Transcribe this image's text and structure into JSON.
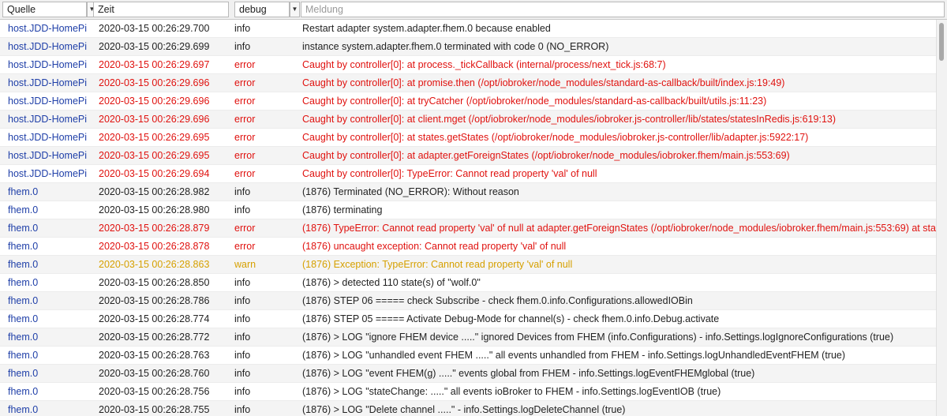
{
  "header": {
    "source_label": "Quelle",
    "time_label": "Zeit",
    "severity_value": "debug",
    "message_placeholder": "Meldung",
    "dropdown_glyph": "▼"
  },
  "colors": {
    "error": "#e0120f",
    "warn": "#d6a000",
    "source": "#1f3fa8"
  },
  "rows": [
    {
      "src": "host.JDD-HomePi",
      "time": "2020-03-15 00:26:29.700",
      "sev": "info",
      "msg": "Restart adapter system.adapter.fhem.0 because enabled"
    },
    {
      "src": "host.JDD-HomePi",
      "time": "2020-03-15 00:26:29.699",
      "sev": "info",
      "msg": "instance system.adapter.fhem.0 terminated with code 0 (NO_ERROR)"
    },
    {
      "src": "host.JDD-HomePi",
      "time": "2020-03-15 00:26:29.697",
      "sev": "error",
      "msg": "Caught by controller[0]: at process._tickCallback (internal/process/next_tick.js:68:7)"
    },
    {
      "src": "host.JDD-HomePi",
      "time": "2020-03-15 00:26:29.696",
      "sev": "error",
      "msg": "Caught by controller[0]: at promise.then (/opt/iobroker/node_modules/standard-as-callback/built/index.js:19:49)"
    },
    {
      "src": "host.JDD-HomePi",
      "time": "2020-03-15 00:26:29.696",
      "sev": "error",
      "msg": "Caught by controller[0]: at tryCatcher (/opt/iobroker/node_modules/standard-as-callback/built/utils.js:11:23)"
    },
    {
      "src": "host.JDD-HomePi",
      "time": "2020-03-15 00:26:29.696",
      "sev": "error",
      "msg": "Caught by controller[0]: at client.mget (/opt/iobroker/node_modules/iobroker.js-controller/lib/states/statesInRedis.js:619:13)"
    },
    {
      "src": "host.JDD-HomePi",
      "time": "2020-03-15 00:26:29.695",
      "sev": "error",
      "msg": "Caught by controller[0]: at states.getStates (/opt/iobroker/node_modules/iobroker.js-controller/lib/adapter.js:5922:17)"
    },
    {
      "src": "host.JDD-HomePi",
      "time": "2020-03-15 00:26:29.695",
      "sev": "error",
      "msg": "Caught by controller[0]: at adapter.getForeignStates (/opt/iobroker/node_modules/iobroker.fhem/main.js:553:69)"
    },
    {
      "src": "host.JDD-HomePi",
      "time": "2020-03-15 00:26:29.694",
      "sev": "error",
      "msg": "Caught by controller[0]: TypeError: Cannot read property 'val' of null"
    },
    {
      "src": "fhem.0",
      "time": "2020-03-15 00:26:28.982",
      "sev": "info",
      "msg": "(1876) Terminated (NO_ERROR): Without reason"
    },
    {
      "src": "fhem.0",
      "time": "2020-03-15 00:26:28.980",
      "sev": "info",
      "msg": "(1876) terminating"
    },
    {
      "src": "fhem.0",
      "time": "2020-03-15 00:26:28.879",
      "sev": "error",
      "msg": "(1876) TypeError: Cannot read property 'val' of null at adapter.getForeignStates (/opt/iobroker/node_modules/iobroker.fhem/main.js:553:69) at sta"
    },
    {
      "src": "fhem.0",
      "time": "2020-03-15 00:26:28.878",
      "sev": "error",
      "msg": "(1876) uncaught exception: Cannot read property 'val' of null"
    },
    {
      "src": "fhem.0",
      "time": "2020-03-15 00:26:28.863",
      "sev": "warn",
      "msg": "(1876) Exception: TypeError: Cannot read property 'val' of null"
    },
    {
      "src": "fhem.0",
      "time": "2020-03-15 00:26:28.850",
      "sev": "info",
      "msg": "(1876) > detected 110 state(s) of \"wolf.0\""
    },
    {
      "src": "fhem.0",
      "time": "2020-03-15 00:26:28.786",
      "sev": "info",
      "msg": "(1876) STEP 06 ===== check Subscribe - check fhem.0.info.Configurations.allowedIOBin"
    },
    {
      "src": "fhem.0",
      "time": "2020-03-15 00:26:28.774",
      "sev": "info",
      "msg": "(1876) STEP 05 ===== Activate Debug-Mode for channel(s) - check fhem.0.info.Debug.activate"
    },
    {
      "src": "fhem.0",
      "time": "2020-03-15 00:26:28.772",
      "sev": "info",
      "msg": "(1876) > LOG \"ignore FHEM device .....\" ignored Devices from FHEM (info.Configurations) - info.Settings.logIgnoreConfigurations (true)"
    },
    {
      "src": "fhem.0",
      "time": "2020-03-15 00:26:28.763",
      "sev": "info",
      "msg": "(1876) > LOG \"unhandled event FHEM .....\" all events unhandled from FHEM - info.Settings.logUnhandledEventFHEM (true)"
    },
    {
      "src": "fhem.0",
      "time": "2020-03-15 00:26:28.760",
      "sev": "info",
      "msg": "(1876) > LOG \"event FHEM(g) .....\" events global from FHEM - info.Settings.logEventFHEMglobal (true)"
    },
    {
      "src": "fhem.0",
      "time": "2020-03-15 00:26:28.756",
      "sev": "info",
      "msg": "(1876) > LOG \"stateChange: .....\" all events ioBroker to FHEM - info.Settings.logEventIOB (true)"
    },
    {
      "src": "fhem.0",
      "time": "2020-03-15 00:26:28.755",
      "sev": "info",
      "msg": "(1876) > LOG \"Delete channel .....\" - info.Settings.logDeleteChannel (true)"
    }
  ]
}
